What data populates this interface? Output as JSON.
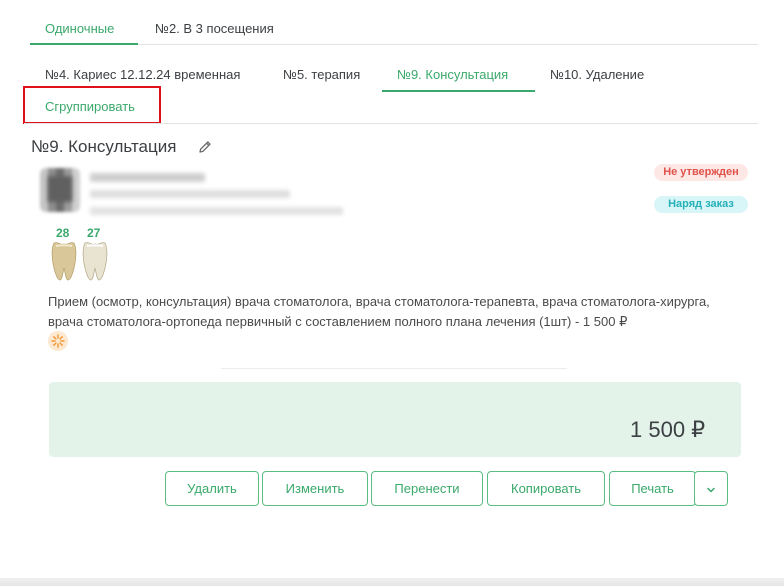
{
  "tabs_row1": [
    {
      "label": "Одиночные",
      "active": true
    },
    {
      "label": "№2. В 3 посещения",
      "active": false
    }
  ],
  "tabs_row2": [
    {
      "label": "№4. Кариес 12.12.24 временная",
      "active": false
    },
    {
      "label": "№5. терапия",
      "active": false
    },
    {
      "label": "№9. Консультация",
      "active": true
    },
    {
      "label": "№10. Удаление",
      "active": false
    }
  ],
  "group_action": {
    "label": "Сгруппировать"
  },
  "visit": {
    "title": "№9. Консультация",
    "status_badge": "Не утвержден",
    "order_badge": "Наряд заказ",
    "teeth": [
      {
        "number": "28"
      },
      {
        "number": "27"
      }
    ],
    "service_description": "Прием (осмотр, консультация) врача стоматолога, врача стоматолога-терапевта, врача стоматолога-хирурга, врача стоматолога-ортопеда первичный с составлением полного плана лечения (1шт) - 1 500 ₽",
    "total": "1 500 ₽"
  },
  "actions": {
    "delete": "Удалить",
    "edit": "Изменить",
    "move": "Перенести",
    "copy": "Копировать",
    "print": "Печать"
  },
  "icons": {
    "edit": "pencil-icon",
    "dropdown": "chevron-down-icon",
    "loading": "spinner-icon"
  },
  "colors": {
    "accent": "#3aa96b",
    "status_red": "#e0524a",
    "status_teal": "#24b1b8",
    "highlight_box": "#e0101b",
    "total_panel": "#e4f3ea"
  }
}
